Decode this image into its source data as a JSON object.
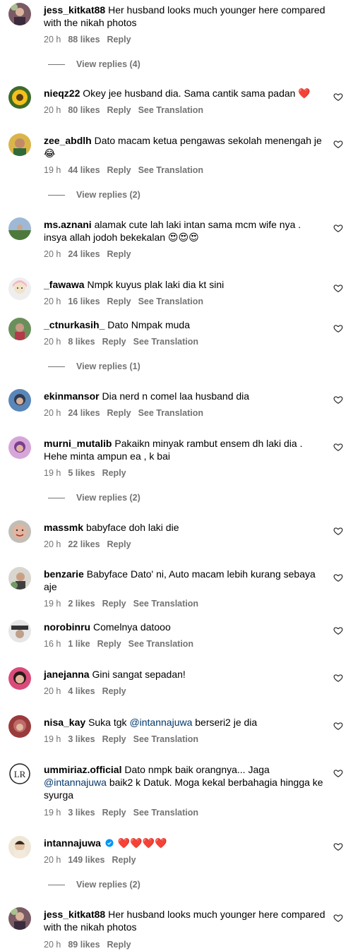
{
  "comments": [
    {
      "user": "jess_kitkat88",
      "text": "Her husband looks much younger here compared with the nikah photos",
      "time": "20 h",
      "likes": "88 likes",
      "reply": "Reply",
      "translation": "",
      "view_replies": "View replies (4)"
    },
    {
      "user": "nieqz22",
      "text": "Okey jee husband dia. Sama cantik sama padan ❤️",
      "time": "20 h",
      "likes": "80 likes",
      "reply": "Reply",
      "translation": "See Translation",
      "view_replies": ""
    },
    {
      "user": "zee_abdlh",
      "text": "Dato macam ketua pengawas sekolah menengah je 😂",
      "time": "19 h",
      "likes": "44 likes",
      "reply": "Reply",
      "translation": "See Translation",
      "view_replies": "View replies (2)"
    },
    {
      "user": "ms.aznani",
      "text": "alamak cute lah laki intan sama mcm wife nya . insya allah jodoh bekekalan 😍😍😍",
      "time": "20 h",
      "likes": "24 likes",
      "reply": "Reply",
      "translation": "",
      "view_replies": ""
    },
    {
      "user": "_fawawa",
      "text": "Nmpk kuyus plak laki dia kt sini",
      "time": "20 h",
      "likes": "16 likes",
      "reply": "Reply",
      "translation": "See Translation",
      "view_replies": ""
    },
    {
      "user": "_ctnurkasih_",
      "text": "Dato Nmpak muda",
      "time": "20 h",
      "likes": "8 likes",
      "reply": "Reply",
      "translation": "See Translation",
      "view_replies": "View replies (1)"
    },
    {
      "user": "ekinmansor",
      "text": "Dia nerd n comel laa husband dia",
      "time": "20 h",
      "likes": "24 likes",
      "reply": "Reply",
      "translation": "See Translation",
      "view_replies": ""
    },
    {
      "user": "murni_mutalib",
      "text": "Pakaikn minyak rambut ensem dh laki dia . Hehe minta ampun ea , k bai",
      "time": "19 h",
      "likes": "5 likes",
      "reply": "Reply",
      "translation": "",
      "view_replies": "View replies (2)"
    },
    {
      "user": "massmk",
      "text": "babyface doh laki die",
      "time": "20 h",
      "likes": "22 likes",
      "reply": "Reply",
      "translation": "",
      "view_replies": ""
    },
    {
      "user": "benzarie",
      "text": "Babyface Dato' ni, Auto macam lebih kurang sebaya aje",
      "time": "19 h",
      "likes": "2 likes",
      "reply": "Reply",
      "translation": "See Translation",
      "view_replies": ""
    },
    {
      "user": "norobinru",
      "text": "Comelnya datooo",
      "time": "16 h",
      "likes": "1 like",
      "reply": "Reply",
      "translation": "See Translation",
      "view_replies": ""
    },
    {
      "user": "janejanna",
      "text": "Gini sangat sepadan!",
      "time": "20 h",
      "likes": "4 likes",
      "reply": "Reply",
      "translation": "",
      "view_replies": ""
    },
    {
      "user": "nisa_kay",
      "text_pre": "Suka tgk ",
      "mention": "@intannajuwa",
      "text_post": " berseri2 je dia",
      "time": "19 h",
      "likes": "3 likes",
      "reply": "Reply",
      "translation": "See Translation",
      "view_replies": ""
    },
    {
      "user": "ummiriaz.official",
      "text_pre": "Dato nmpk baik orangnya... Jaga ",
      "mention": "@intannajuwa",
      "text_post": " baik2 k Datuk. Moga kekal berbahagia hingga ke syurga",
      "time": "19 h",
      "likes": "3 likes",
      "reply": "Reply",
      "translation": "See Translation",
      "view_replies": ""
    },
    {
      "user": "intannajuwa",
      "text": "❤️❤️❤️❤️",
      "time": "20 h",
      "likes": "149 likes",
      "reply": "Reply",
      "translation": "",
      "view_replies": "View replies (2)"
    },
    {
      "user": "jess_kitkat88",
      "text": "Her husband looks much younger here compared with the nikah photos",
      "time": "20 h",
      "likes": "89 likes",
      "reply": "Reply",
      "translation": "",
      "view_replies": ""
    }
  ],
  "avatar_logo_text": "LR",
  "colors": {
    "meta": "#737373",
    "mention": "#00376b",
    "verified": "#0095f6"
  }
}
